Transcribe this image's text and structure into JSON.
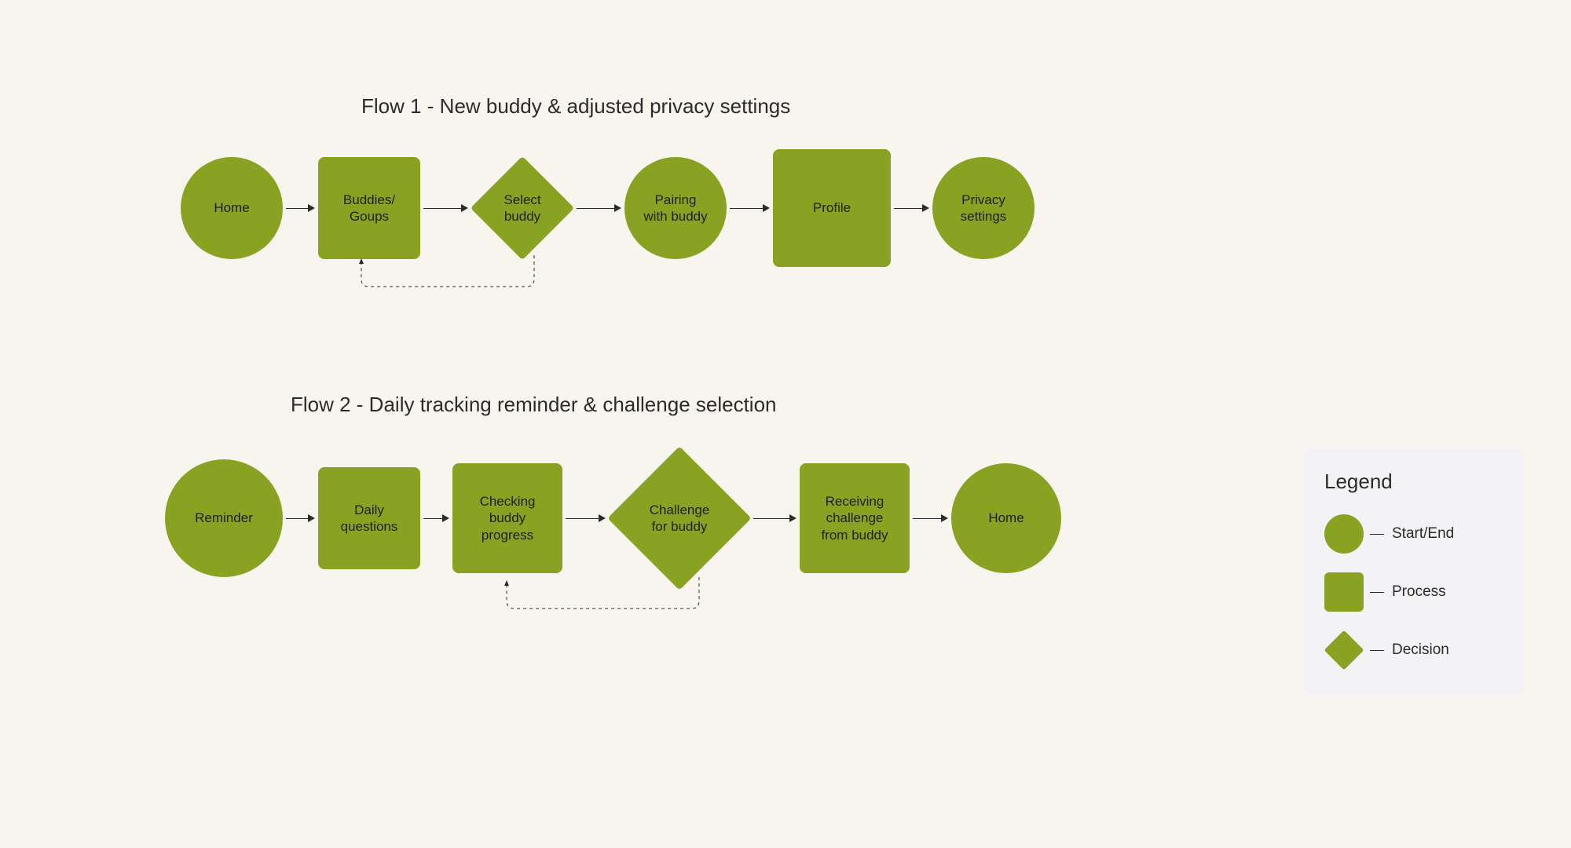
{
  "flow1": {
    "title": "Flow 1 - New buddy & adjusted privacy settings",
    "nodes": {
      "home": "Home",
      "buddies": "Buddies/\nGoups",
      "select": "Select\nbuddy",
      "pairing": "Pairing\nwith buddy",
      "profile": "Profile",
      "privacy": "Privacy\nsettings"
    }
  },
  "flow2": {
    "title": "Flow 2 - Daily tracking reminder & challenge selection",
    "nodes": {
      "reminder": "Reminder",
      "daily": "Daily\nquestions",
      "checking": "Checking\nbuddy\nprogress",
      "challenge": "Challenge\nfor buddy",
      "receiving": "Receiving\nchallenge\nfrom buddy",
      "home": "Home"
    }
  },
  "legend": {
    "title": "Legend",
    "start_end": "Start/End",
    "process": "Process",
    "decision": "Decision"
  }
}
